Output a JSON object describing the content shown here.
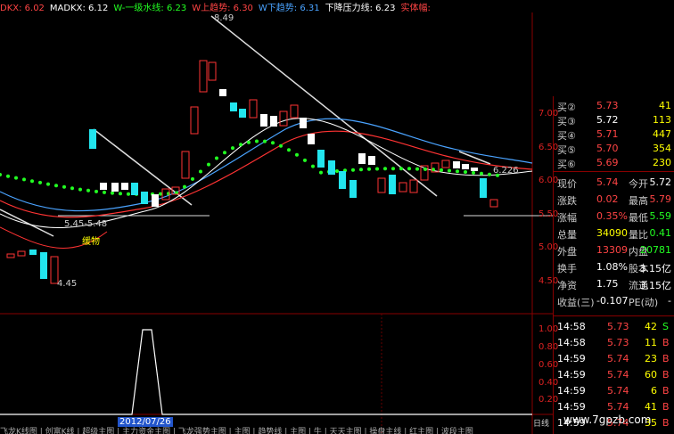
{
  "indicators": [
    {
      "text": "DKX: 6.02",
      "color": "#ff4444"
    },
    {
      "text": "MADKX: 6.12",
      "color": "#ffffff"
    },
    {
      "text": "W-一级水线: 6.23",
      "color": "#22ff22"
    },
    {
      "text": "W上趋势: 6.30",
      "color": "#ff4444"
    },
    {
      "text": "W下趋势: 6.31",
      "color": "#4aa3ff"
    },
    {
      "text": "下降压力线: 6.23",
      "color": "#ffffff"
    },
    {
      "text": "实体幅:",
      "color": "#ff4444"
    }
  ],
  "price_axis": [
    "7.00",
    "6.50",
    "6.00",
    "5.50",
    "5.00",
    "4.50"
  ],
  "lower_axis": [
    "1.00",
    "0.80",
    "0.60",
    "0.40",
    "0.20"
  ],
  "annotations": {
    "high": "8.49",
    "low": "4.45",
    "range": "5.45-5.48",
    "mark": "缓物",
    "last": "6.226"
  },
  "date_label": "2012/07/26",
  "axis_end": "日线",
  "bottom_tabs": "飞龙K线图 | 创富K线 | 超级主图 | 主力资金主图 | 飞龙强势主图 | 主图 | 趋势线 | 主图 | 牛 | 天天主图 | 操盘主线 | 红主图 | 波段主图",
  "bids": [
    {
      "label": "买②",
      "price": "5.73",
      "vol": "41"
    },
    {
      "label": "买③",
      "price": "5.72",
      "vol": "113"
    },
    {
      "label": "买④",
      "price": "5.71",
      "vol": "447"
    },
    {
      "label": "买⑤",
      "price": "5.70",
      "vol": "354"
    },
    {
      "label": "买⑥",
      "price": "5.69",
      "vol": "230"
    }
  ],
  "stats": [
    {
      "k": "现价",
      "v": "5.74",
      "k2": "今开",
      "v2": "5.72",
      "c": "#ff4444",
      "c2": "#ffffff"
    },
    {
      "k": "涨跌",
      "v": "0.02",
      "k2": "最高",
      "v2": "5.79",
      "c": "#ff4444",
      "c2": "#ff4444"
    },
    {
      "k": "涨幅",
      "v": "0.35%",
      "k2": "最低",
      "v2": "5.59",
      "c": "#ff4444",
      "c2": "#22ff22"
    },
    {
      "k": "总量",
      "v": "34090",
      "k2": "量比",
      "v2": "0.41",
      "c": "#ffff00",
      "c2": "#22ff22"
    },
    {
      "k": "外盘",
      "v": "13309",
      "k2": "内盘",
      "v2": "20781",
      "c": "#ff4444",
      "c2": "#22ff22"
    },
    {
      "k": "换手",
      "v": "1.08%",
      "k2": "股本",
      "v2": "3.15亿",
      "c": "#ffffff",
      "c2": "#ffffff"
    },
    {
      "k": "净资",
      "v": "1.75",
      "k2": "流通",
      "v2": "3.15亿",
      "c": "#ffffff",
      "c2": "#ffffff"
    },
    {
      "k": "收益(三)",
      "v": "-0.107",
      "k2": "PE(动)",
      "v2": "-",
      "c": "#ffffff",
      "c2": "#ffffff"
    }
  ],
  "ticks": [
    {
      "t": "14:58",
      "p": "5.73",
      "v": "42",
      "s": "S",
      "pc": "#ff4444",
      "sc": "#22ff22"
    },
    {
      "t": "14:58",
      "p": "5.73",
      "v": "11",
      "s": "B",
      "pc": "#ff4444",
      "sc": "#ff4444"
    },
    {
      "t": "14:59",
      "p": "5.74",
      "v": "23",
      "s": "B",
      "pc": "#ff4444",
      "sc": "#ff4444"
    },
    {
      "t": "14:59",
      "p": "5.74",
      "v": "60",
      "s": "B",
      "pc": "#ff4444",
      "sc": "#ff4444"
    },
    {
      "t": "14:59",
      "p": "5.74",
      "v": "6",
      "s": "B",
      "pc": "#ff4444",
      "sc": "#ff4444"
    },
    {
      "t": "14:59",
      "p": "5.74",
      "v": "41",
      "s": "B",
      "pc": "#ff4444",
      "sc": "#ff4444"
    },
    {
      "t": "14:59",
      "p": "5.74",
      "v": "35",
      "s": "B",
      "pc": "#ff4444",
      "sc": "#ff4444"
    }
  ],
  "watermark": "www.7gpzb.com"
}
